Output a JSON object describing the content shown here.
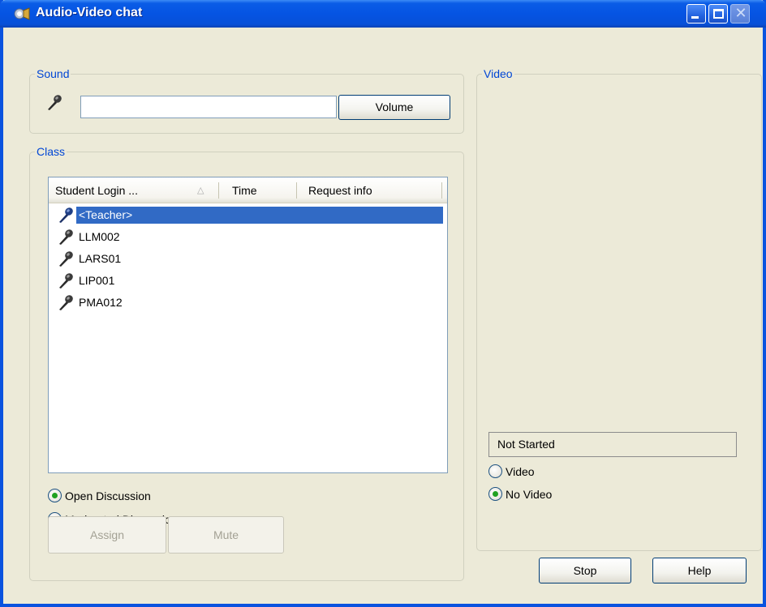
{
  "window": {
    "title": "Audio-Video chat",
    "title_icon": "audio-video-chat-icon",
    "controls": [
      "minimize",
      "maximize",
      "close"
    ]
  },
  "sound": {
    "legend": "Sound",
    "mic_icon": "microphone-icon",
    "level_value": "",
    "volume_label": "Volume"
  },
  "class": {
    "legend": "Class",
    "columns": [
      "Student Login ...",
      "Time",
      "Request info"
    ],
    "sort_indicator": "ascending",
    "rows": [
      {
        "login": "<Teacher>",
        "time": "",
        "request_info": "",
        "selected": true,
        "icon": "microphone-icon"
      },
      {
        "login": "LLM002",
        "time": "",
        "request_info": "",
        "selected": false,
        "icon": "microphone-icon"
      },
      {
        "login": "LARS01",
        "time": "",
        "request_info": "",
        "selected": false,
        "icon": "microphone-icon"
      },
      {
        "login": "LIP001",
        "time": "",
        "request_info": "",
        "selected": false,
        "icon": "microphone-icon"
      },
      {
        "login": "PMA012",
        "time": "",
        "request_info": "",
        "selected": false,
        "icon": "microphone-icon"
      }
    ],
    "discussion_options": [
      {
        "label": "Open Discussion",
        "checked": true
      },
      {
        "label": "Moderated Discussion",
        "checked": false
      }
    ],
    "assign_label": "Assign",
    "mute_label": "Mute"
  },
  "video": {
    "legend": "Video",
    "status": "Not Started",
    "options": [
      {
        "label": "Video",
        "checked": false
      },
      {
        "label": "No Video",
        "checked": true
      }
    ]
  },
  "footer": {
    "stop_label": "Stop",
    "help_label": "Help"
  },
  "colors": {
    "titlebar": "#0554e3",
    "window_bg": "#ecead8",
    "legend_text": "#0046d5",
    "selection": "#316ac5",
    "radio_dot": "#21a121"
  }
}
